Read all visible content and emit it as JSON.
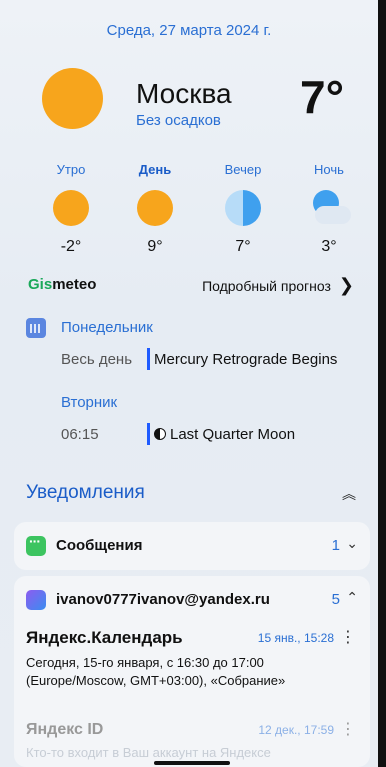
{
  "header": {
    "date": "Среда, 27 марта 2024 г."
  },
  "weather": {
    "city": "Москва",
    "condition": "Без осадков",
    "temperature": "7°",
    "periods": [
      {
        "label": "Утро",
        "temp": "-2°",
        "icon": "sun-icon"
      },
      {
        "label": "День",
        "temp": "9°",
        "icon": "sun-icon"
      },
      {
        "label": "Вечер",
        "temp": "7°",
        "icon": "half-moon-icon"
      },
      {
        "label": "Ночь",
        "temp": "3°",
        "icon": "cloudy-moon-icon"
      }
    ],
    "provider_prefix": "Gis",
    "provider_suffix": "meteo",
    "forecast_link": "Подробный прогноз"
  },
  "calendar": {
    "days": [
      {
        "day": "Понедельник",
        "time": "Весь день",
        "title": "Mercury Retrograde Begins"
      },
      {
        "day": "Вторник",
        "time": "06:15",
        "title": "Last Quarter Moon"
      }
    ]
  },
  "notifications": {
    "heading": "Уведомления",
    "apps": [
      {
        "name": "Сообщения",
        "count": "1"
      },
      {
        "name": "ivanov0777ivanov@yandex.ru",
        "count": "5"
      }
    ],
    "items": [
      {
        "title": "Яндекс.Календарь",
        "time": "15 янв., 15:28",
        "body": "Сегодня, 15-го января, с 16:30 до 17:00 (Europe/Moscow, GMT+03:00), «Собрание»"
      },
      {
        "title": "Яндекс ID",
        "time": "12 дек., 17:59",
        "body": "Кто-то входит в Ваш аккаунт на Яндексе"
      }
    ]
  },
  "colors": {
    "accent": "#2a6fd3",
    "sun": "#f7a51c",
    "event_bar": "#1f5bff"
  }
}
